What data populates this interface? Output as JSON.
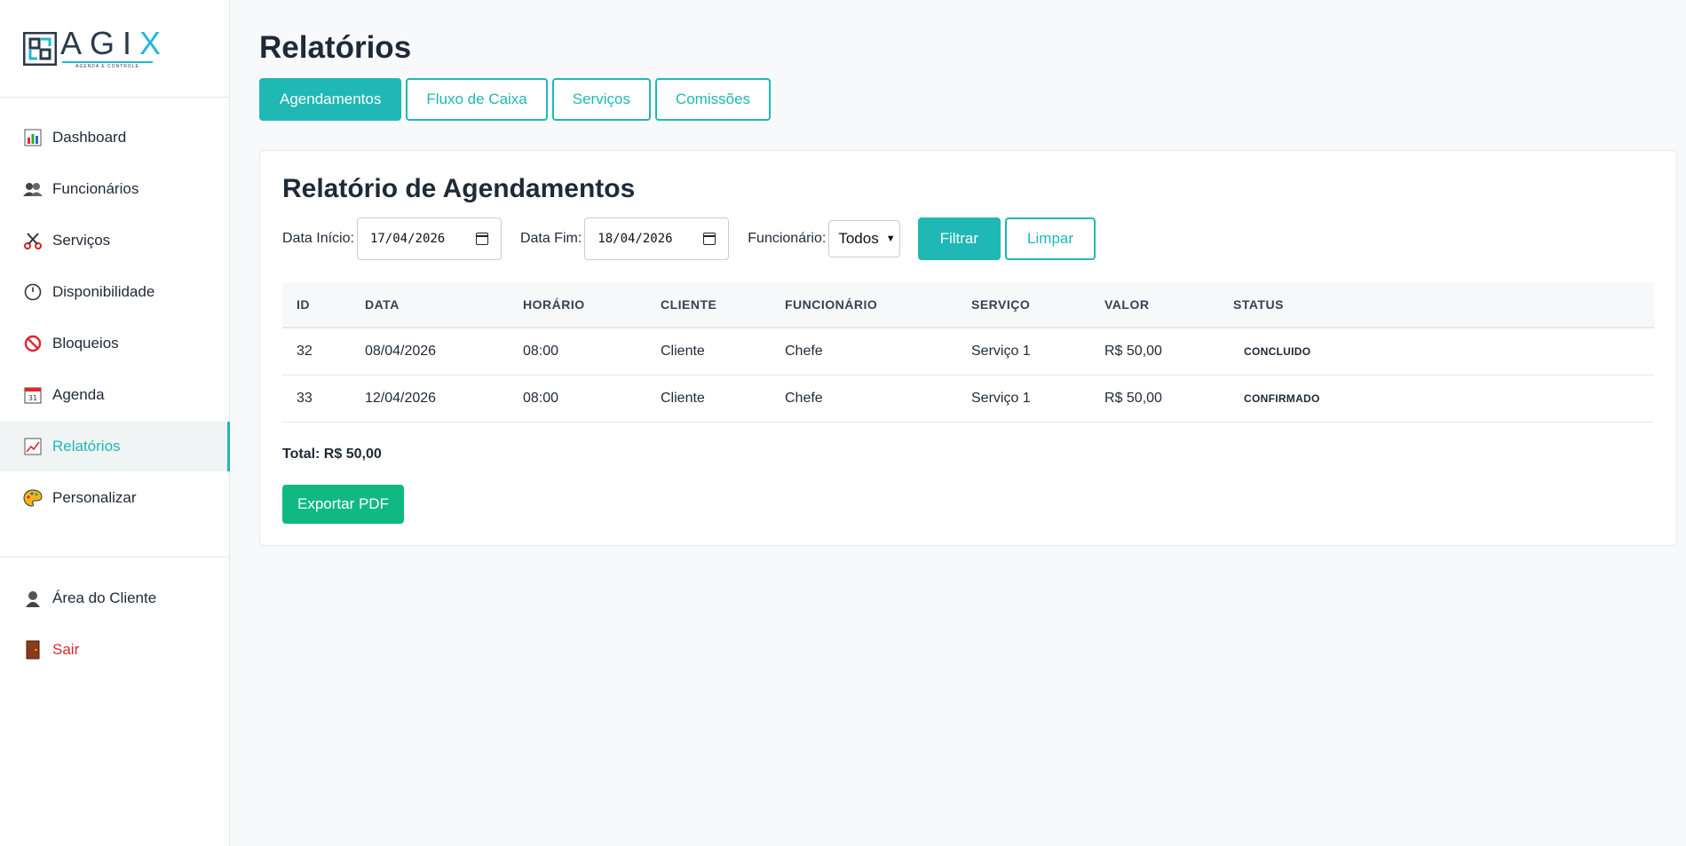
{
  "brand": {
    "name_main": "AGI",
    "name_accent": "X",
    "tagline": "AGENDA E CONTROLE"
  },
  "sidebar": {
    "items": [
      {
        "label": "Dashboard",
        "icon": "bar-chart-icon"
      },
      {
        "label": "Funcionários",
        "icon": "people-icon"
      },
      {
        "label": "Serviços",
        "icon": "scissors-icon"
      },
      {
        "label": "Disponibilidade",
        "icon": "clock-icon"
      },
      {
        "label": "Bloqueios",
        "icon": "prohibited-icon"
      },
      {
        "label": "Agenda",
        "icon": "calendar-icon"
      },
      {
        "label": "Relatórios",
        "icon": "trend-chart-icon",
        "active": true
      },
      {
        "label": "Personalizar",
        "icon": "palette-icon"
      }
    ],
    "footer_items": [
      {
        "label": "Área do Cliente",
        "icon": "user-icon"
      },
      {
        "label": "Sair",
        "icon": "door-icon"
      }
    ]
  },
  "page": {
    "title": "Relatórios",
    "tabs": [
      "Agendamentos",
      "Fluxo de Caixa",
      "Serviços",
      "Comissões"
    ],
    "active_tab": "Agendamentos"
  },
  "report": {
    "title": "Relatório de Agendamentos",
    "filters": {
      "start_label": "Data Início:",
      "start_value": "17/04/2026",
      "end_label": "Data Fim:",
      "end_value": "18/04/2026",
      "employee_label": "Funcionário:",
      "employee_value": "Todos",
      "filter_button": "Filtrar",
      "clear_button": "Limpar"
    },
    "columns": [
      "ID",
      "DATA",
      "HORÁRIO",
      "CLIENTE",
      "FUNCIONÁRIO",
      "SERVIÇO",
      "VALOR",
      "STATUS"
    ],
    "rows": [
      [
        "32",
        "08/04/2026",
        "08:00",
        "Cliente",
        "Chefe",
        "Serviço 1",
        "R$ 50,00",
        "CONCLUIDO"
      ],
      [
        "33",
        "12/04/2026",
        "08:00",
        "Cliente",
        "Chefe",
        "Serviço 1",
        "R$ 50,00",
        "CONFIRMADO"
      ]
    ],
    "total": "Total: R$ 50,00",
    "export_button": "Exportar PDF"
  },
  "colors": {
    "accent": "#1fb8b4",
    "export": "#10b981",
    "danger": "#e0262f"
  }
}
